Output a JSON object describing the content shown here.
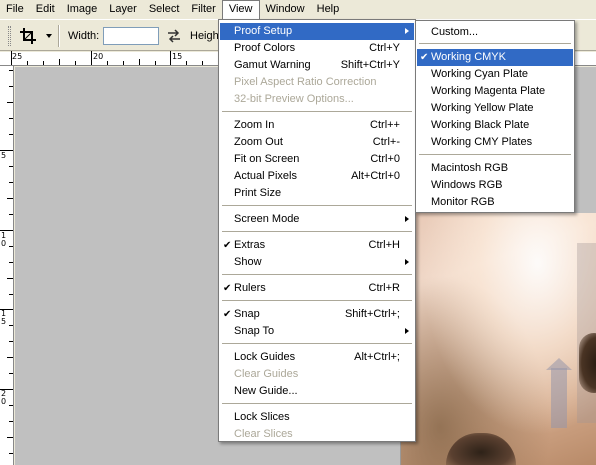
{
  "menubar": {
    "items": [
      "File",
      "Edit",
      "Image",
      "Layer",
      "Select",
      "Filter",
      "View",
      "Window",
      "Help"
    ],
    "open_index": 6
  },
  "options_bar": {
    "tool_icon": "crop-icon",
    "width_label": "Width:",
    "width_value": "",
    "swap_icon": "swap-arrows-icon",
    "height_label": "Heigh"
  },
  "ruler_top_labels": [
    "25",
    "20",
    "15"
  ],
  "ruler_left_labels": [
    "5",
    "1 0",
    "1 5",
    "2 0"
  ],
  "view_menu": {
    "items": [
      {
        "label": "Proof Setup",
        "shortcut": "",
        "submenu": true,
        "highlighted": true,
        "disabled": false,
        "checked": false
      },
      {
        "label": "Proof Colors",
        "shortcut": "Ctrl+Y",
        "submenu": false,
        "highlighted": false,
        "disabled": false,
        "checked": false
      },
      {
        "label": "Gamut Warning",
        "shortcut": "Shift+Ctrl+Y",
        "submenu": false,
        "highlighted": false,
        "disabled": false,
        "checked": false
      },
      {
        "label": "Pixel Aspect Ratio Correction",
        "shortcut": "",
        "submenu": false,
        "highlighted": false,
        "disabled": true,
        "checked": false
      },
      {
        "label": "32-bit Preview Options...",
        "shortcut": "",
        "submenu": false,
        "highlighted": false,
        "disabled": true,
        "checked": false
      },
      {
        "label": "Zoom In",
        "shortcut": "Ctrl++",
        "submenu": false,
        "highlighted": false,
        "disabled": false,
        "checked": false
      },
      {
        "label": "Zoom Out",
        "shortcut": "Ctrl+-",
        "submenu": false,
        "highlighted": false,
        "disabled": false,
        "checked": false
      },
      {
        "label": "Fit on Screen",
        "shortcut": "Ctrl+0",
        "submenu": false,
        "highlighted": false,
        "disabled": false,
        "checked": false
      },
      {
        "label": "Actual Pixels",
        "shortcut": "Alt+Ctrl+0",
        "submenu": false,
        "highlighted": false,
        "disabled": false,
        "checked": false
      },
      {
        "label": "Print Size",
        "shortcut": "",
        "submenu": false,
        "highlighted": false,
        "disabled": false,
        "checked": false
      },
      {
        "label": "Screen Mode",
        "shortcut": "",
        "submenu": true,
        "highlighted": false,
        "disabled": false,
        "checked": false
      },
      {
        "label": "Extras",
        "shortcut": "Ctrl+H",
        "submenu": false,
        "highlighted": false,
        "disabled": false,
        "checked": true
      },
      {
        "label": "Show",
        "shortcut": "",
        "submenu": true,
        "highlighted": false,
        "disabled": false,
        "checked": false
      },
      {
        "label": "Rulers",
        "shortcut": "Ctrl+R",
        "submenu": false,
        "highlighted": false,
        "disabled": false,
        "checked": true
      },
      {
        "label": "Snap",
        "shortcut": "Shift+Ctrl+;",
        "submenu": false,
        "highlighted": false,
        "disabled": false,
        "checked": true
      },
      {
        "label": "Snap To",
        "shortcut": "",
        "submenu": true,
        "highlighted": false,
        "disabled": false,
        "checked": false
      },
      {
        "label": "Lock Guides",
        "shortcut": "Alt+Ctrl+;",
        "submenu": false,
        "highlighted": false,
        "disabled": false,
        "checked": false
      },
      {
        "label": "Clear Guides",
        "shortcut": "",
        "submenu": false,
        "highlighted": false,
        "disabled": true,
        "checked": false
      },
      {
        "label": "New Guide...",
        "shortcut": "",
        "submenu": false,
        "highlighted": false,
        "disabled": false,
        "checked": false
      },
      {
        "label": "Lock Slices",
        "shortcut": "",
        "submenu": false,
        "highlighted": false,
        "disabled": false,
        "checked": false
      },
      {
        "label": "Clear Slices",
        "shortcut": "",
        "submenu": false,
        "highlighted": false,
        "disabled": true,
        "checked": false
      }
    ]
  },
  "proof_setup_menu": {
    "items": [
      {
        "label": "Custom...",
        "highlighted": false,
        "checked": false
      },
      {
        "label": "Working CMYK",
        "highlighted": true,
        "checked": true
      },
      {
        "label": "Working Cyan Plate",
        "highlighted": false,
        "checked": false
      },
      {
        "label": "Working Magenta Plate",
        "highlighted": false,
        "checked": false
      },
      {
        "label": "Working Yellow Plate",
        "highlighted": false,
        "checked": false
      },
      {
        "label": "Working Black Plate",
        "highlighted": false,
        "checked": false
      },
      {
        "label": "Working CMY Plates",
        "highlighted": false,
        "checked": false
      },
      {
        "label": "Macintosh RGB",
        "highlighted": false,
        "checked": false
      },
      {
        "label": "Windows RGB",
        "highlighted": false,
        "checked": false
      },
      {
        "label": "Monitor RGB",
        "highlighted": false,
        "checked": false
      }
    ]
  },
  "colors": {
    "highlight": "#316ac5",
    "disabled_text": "#aca899",
    "menubar_bg": "#ece9d8",
    "pasteboard": "#c0c0c0"
  }
}
